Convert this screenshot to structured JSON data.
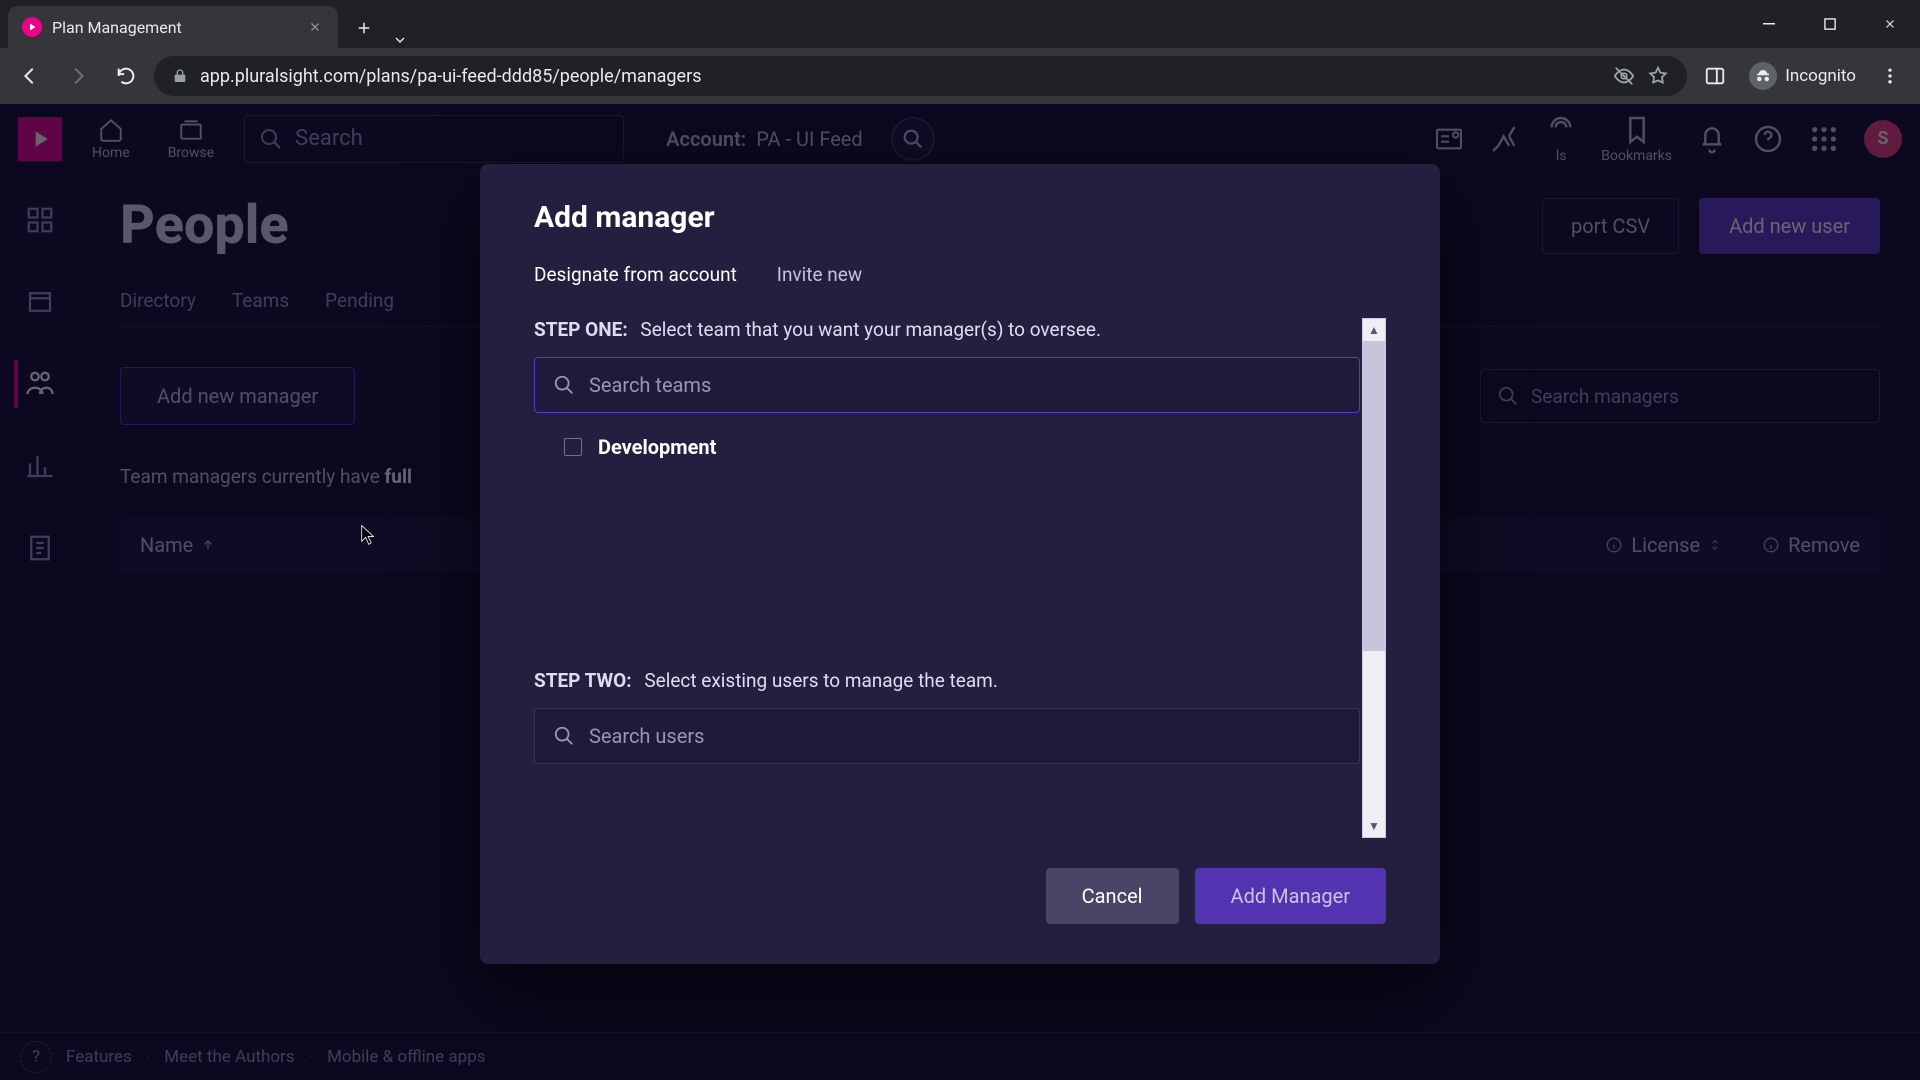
{
  "browser": {
    "tab_title": "Plan Management",
    "url": "app.pluralsight.com/plans/pa-ui-feed-ddd85/people/managers",
    "incognito_label": "Incognito"
  },
  "header": {
    "nav": {
      "home": "Home",
      "browse": "Browse",
      "bookmarks": "Bookmarks"
    },
    "search_placeholder": "Search",
    "account_label": "Account:",
    "account_value": "PA - UI Feed",
    "avatar_initial": "S"
  },
  "page": {
    "title": "People",
    "export_csv": "port CSV",
    "add_user": "Add new user",
    "tabs": [
      "Directory",
      "Teams",
      "Pending"
    ],
    "add_manager_btn": "Add new manager",
    "search_managers_placeholder": "Search managers",
    "info_prefix": "Team managers currently have ",
    "info_bold": "full",
    "col_name": "Name",
    "col_license": "License",
    "col_remove": "Remove"
  },
  "modal": {
    "title": "Add manager",
    "tabs": {
      "designate": "Designate from account",
      "invite": "Invite new"
    },
    "step_one_tag": "STEP ONE:",
    "step_one_text": "Select team that you want your manager(s) to oversee.",
    "search_teams_placeholder": "Search teams",
    "teams": [
      {
        "name": "Development"
      }
    ],
    "step_two_tag": "STEP TWO:",
    "step_two_text": "Select existing users to manage the team.",
    "search_users_placeholder": "Search users",
    "cancel": "Cancel",
    "submit": "Add Manager"
  },
  "footer": {
    "links": [
      "Features",
      "Meet the Authors",
      "Mobile & offline apps"
    ]
  }
}
